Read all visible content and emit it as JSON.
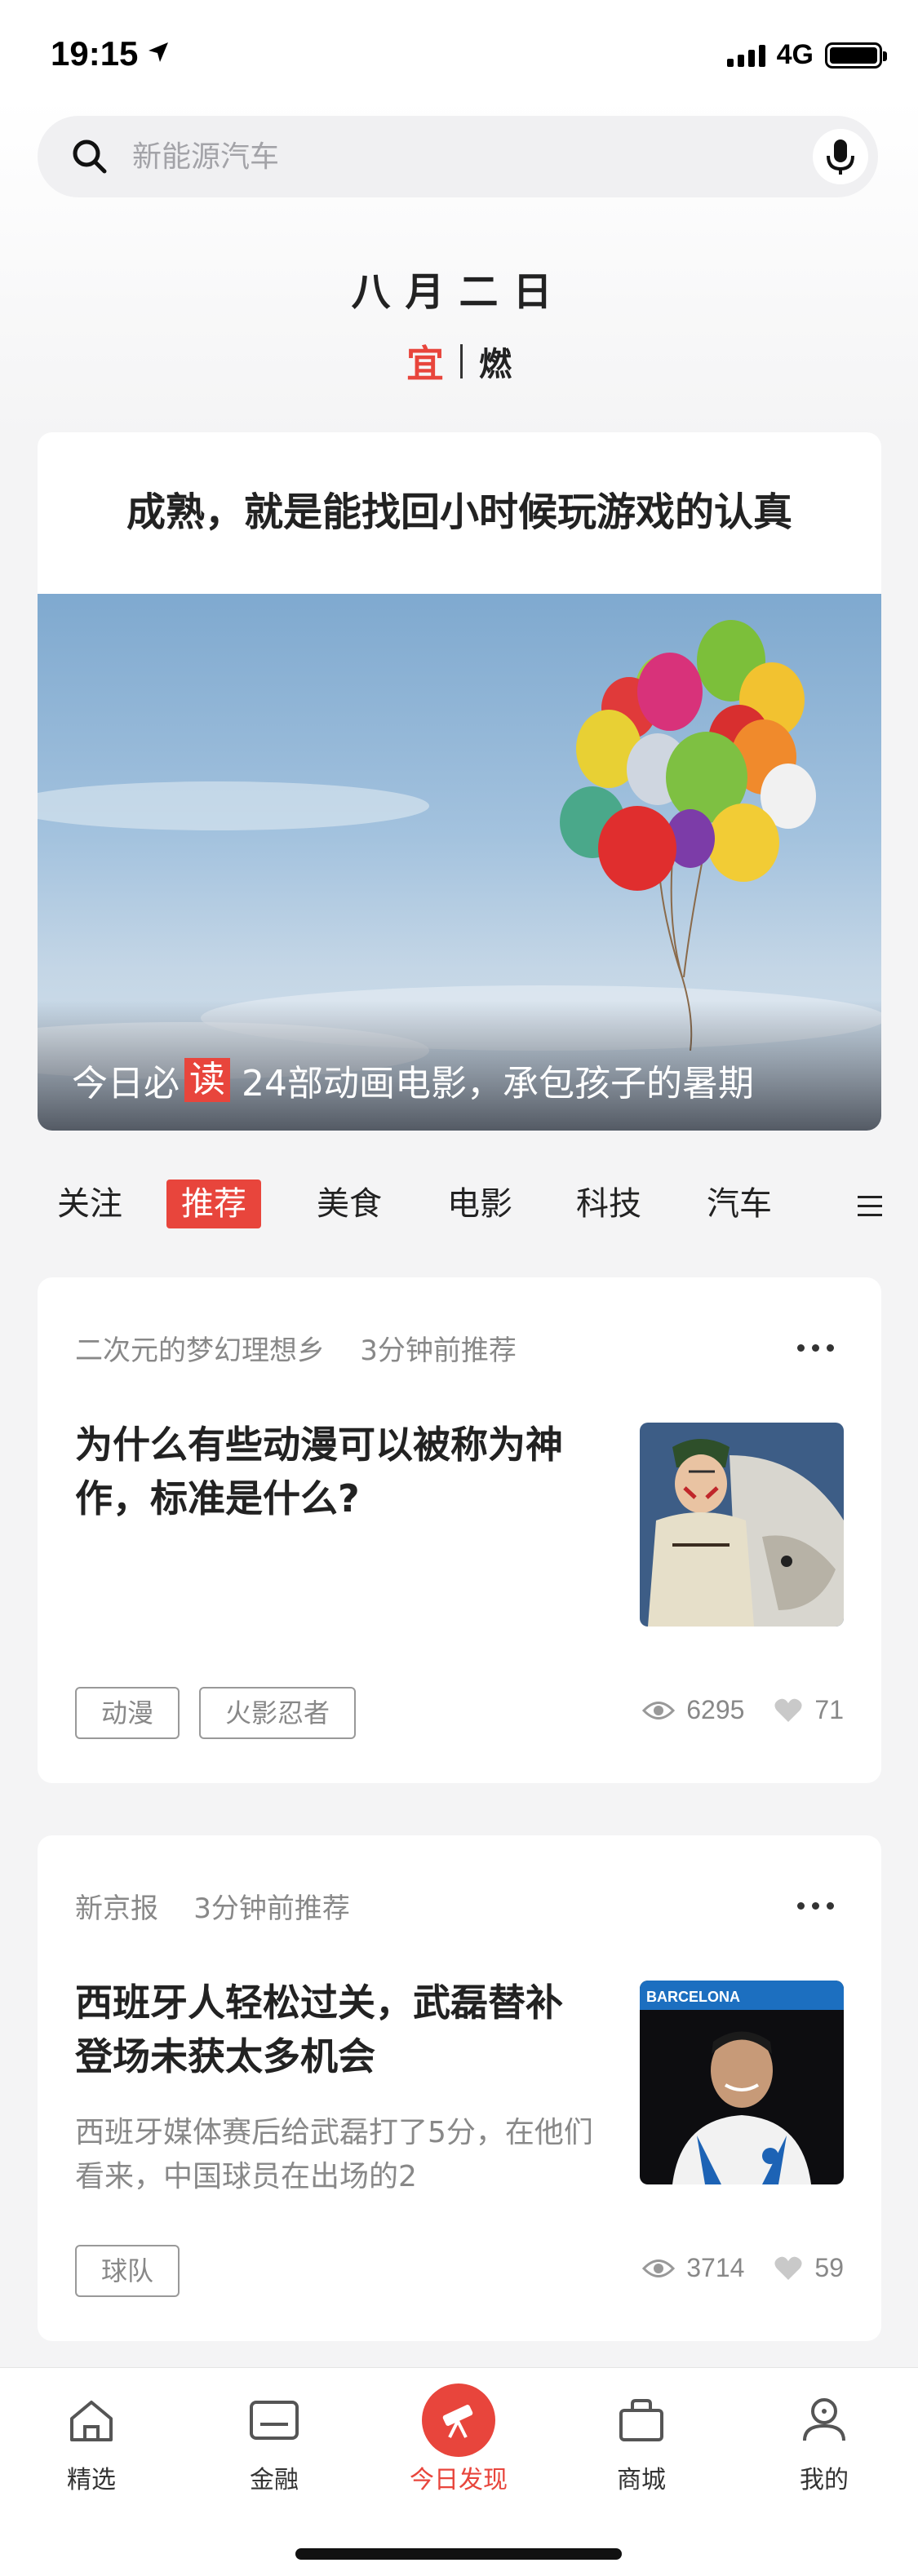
{
  "status_bar": {
    "time": "19:15",
    "network": "4G"
  },
  "search": {
    "placeholder": "新能源汽车"
  },
  "almanac": {
    "date": "八月二日",
    "yi_label": "宜",
    "yi_value": "燃"
  },
  "feature": {
    "headline": "成熟，就是能找回小时候玩游戏的认真",
    "caption_prefix": "今日必",
    "caption_badge": "读",
    "caption_text": "24部动画电影，承包孩子的暑期"
  },
  "tabs": [
    {
      "label": "关注",
      "active": false
    },
    {
      "label": "推荐",
      "active": true
    },
    {
      "label": "美食",
      "active": false
    },
    {
      "label": "电影",
      "active": false
    },
    {
      "label": "科技",
      "active": false
    },
    {
      "label": "汽车",
      "active": false
    }
  ],
  "articles": [
    {
      "source": "二次元的梦幻理想乡",
      "time": "3分钟前推荐",
      "title": "为什么有些动漫可以被称为神作，标准是什么?",
      "summary": "",
      "tags": [
        "动漫",
        "火影忍者"
      ],
      "views": "6295",
      "likes": "71",
      "thumb_icon": "anime-character-image"
    },
    {
      "source": "新京报",
      "time": "3分钟前推荐",
      "title": "西班牙人轻松过关，武磊替补登场未获太多机会",
      "summary": "西班牙媒体赛后给武磊打了5分，在他们看来，中国球员在出场的2",
      "tags": [
        "球队"
      ],
      "views": "3714",
      "likes": "59",
      "thumb_label": "BARCELONA"
    }
  ],
  "bottom_nav": [
    {
      "label": "精选",
      "icon": "home-icon",
      "active": false
    },
    {
      "label": "金融",
      "icon": "card-icon",
      "active": false
    },
    {
      "label": "今日发现",
      "icon": "telescope-icon",
      "active": true
    },
    {
      "label": "商城",
      "icon": "bag-icon",
      "active": false
    },
    {
      "label": "我的",
      "icon": "user-icon",
      "active": false
    }
  ],
  "colors": {
    "accent": "#e8453c",
    "background": "#f4f4f5"
  }
}
